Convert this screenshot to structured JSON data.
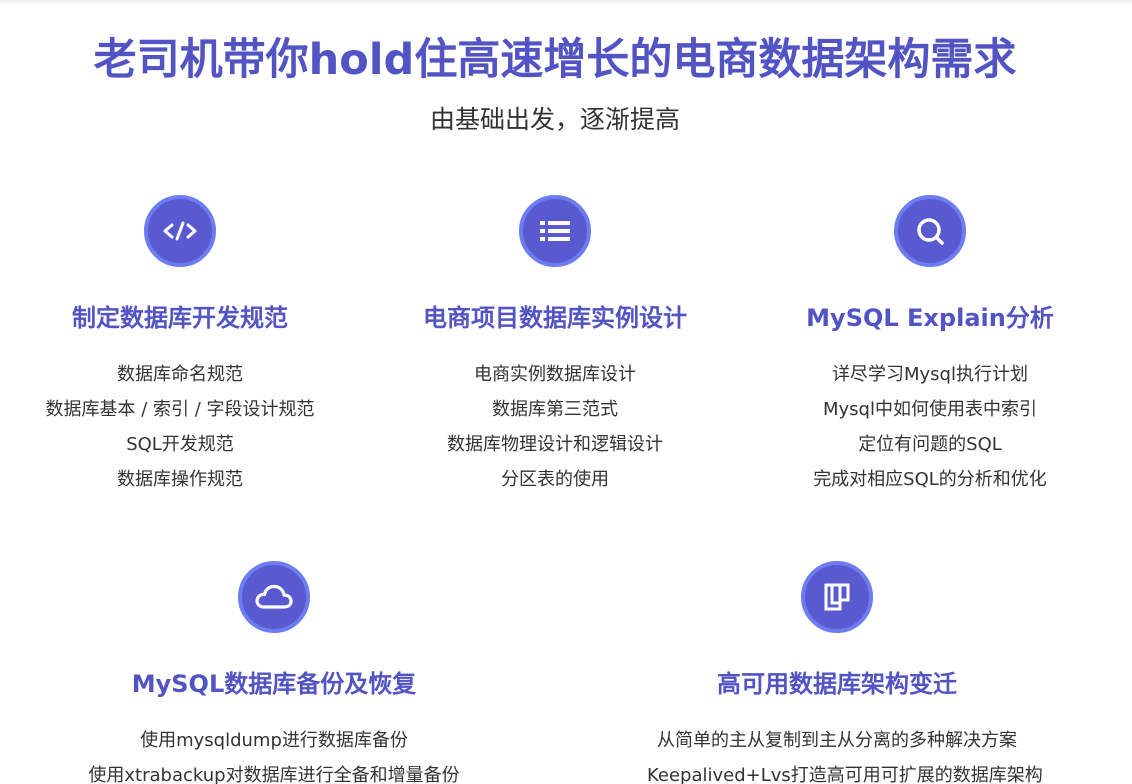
{
  "header": {
    "title": "老司机带你hold住高速增长的电商数据架构需求",
    "subtitle": "由基础出发，逐渐提高"
  },
  "colors": {
    "accent": "#5254c4",
    "icon_fill": "#5a5ad0",
    "icon_ring": "#6d7cf0",
    "text": "#333333"
  },
  "features": [
    {
      "icon": "code-icon",
      "title": "制定数据库开发规范",
      "items": [
        "数据库命名规范",
        "数据库基本 / 索引 / 字段设计规范",
        "SQL开发规范",
        "数据库操作规范"
      ]
    },
    {
      "icon": "list-icon",
      "title": "电商项目数据库实例设计",
      "items": [
        "电商实例数据库设计",
        "数据库第三范式",
        "数据库物理设计和逻辑设计",
        "分区表的使用"
      ]
    },
    {
      "icon": "search-icon",
      "title": "MySQL Explain分析",
      "items": [
        "详尽学习Mysql执行计划",
        "Mysql中如何使用表中索引",
        "定位有问题的SQL",
        "完成对相应SQL的分析和优化"
      ]
    },
    {
      "icon": "cloud-icon",
      "title": "MySQL数据库备份及恢复",
      "items": [
        "使用mysqldump进行数据库备份",
        "使用xtrabackup对数据库进行全备和增量备份"
      ]
    },
    {
      "icon": "layout-icon",
      "title": "高可用数据库架构变迁",
      "items": [
        "从简单的主从复制到主从分离的多种解决方案",
        "Keepalived+Lvs打造高可用可扩展的数据库架构"
      ]
    }
  ]
}
